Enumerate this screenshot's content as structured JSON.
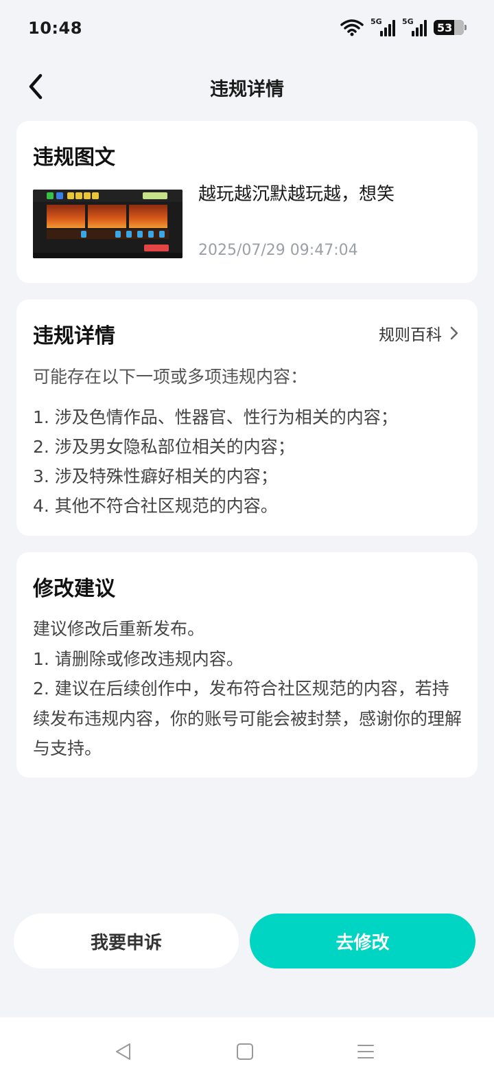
{
  "status_bar": {
    "time": "10:48",
    "signal_1_label": "5G",
    "signal_2_label": "5G",
    "battery": "53",
    "icons": [
      "wifi-icon",
      "signal-icon",
      "signal-icon",
      "battery-icon"
    ]
  },
  "header": {
    "title": "违规详情",
    "back_icon": "chevron-left-icon"
  },
  "post_card": {
    "title": "违规图文",
    "post_text": "越玩越沉默越玩越，想笑",
    "post_time": "2025/07/29 09:47:04"
  },
  "detail_card": {
    "title": "违规详情",
    "rules_link": "规则百科",
    "intro": "可能存在以下一项或多项违规内容：",
    "items": [
      "1. 涉及色情作品、性器官、性行为相关的内容；",
      "2. 涉及男女隐私部位相关的内容；",
      "3. 涉及特殊性癖好相关的内容；",
      "4. 其他不符合社区规范的内容。"
    ]
  },
  "suggest_card": {
    "title": "修改建议",
    "lines": [
      "建议修改后重新发布。",
      "1. 请删除或修改违规内容。",
      "2. 建议在后续创作中，发布符合社区规范的内容，若持续发布违规内容，你的账号可能会被封禁，感谢你的理解与支持。"
    ]
  },
  "actions": {
    "appeal": "我要申诉",
    "modify": "去修改"
  },
  "colors": {
    "accent": "#00d4c3",
    "background": "#f3f4f8"
  }
}
